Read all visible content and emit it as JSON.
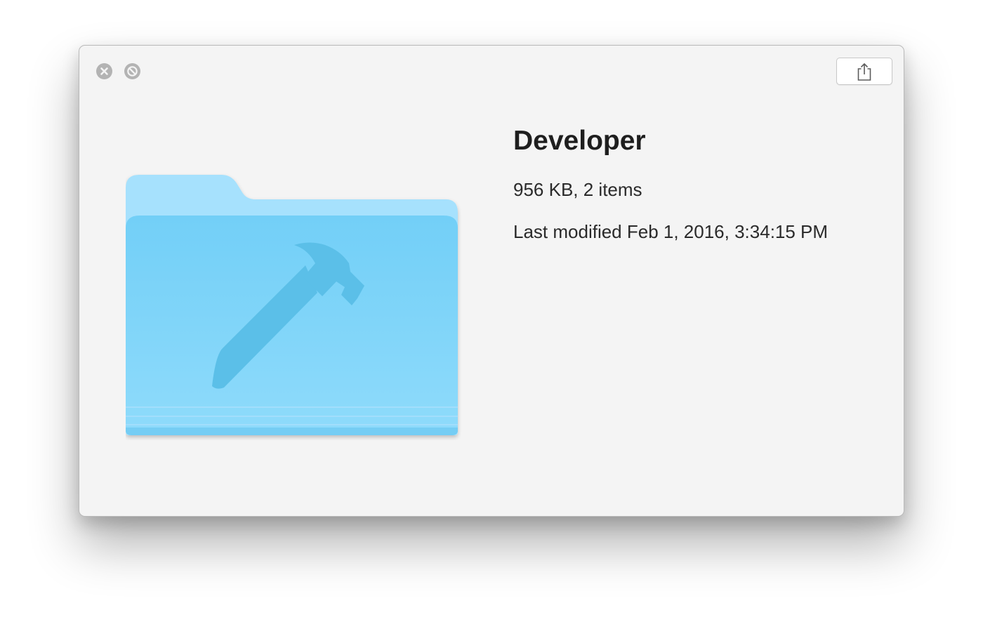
{
  "window": {
    "controls": {
      "close_icon": "close-icon",
      "fullscreen_icon": "fullscreen-disabled-icon"
    },
    "share_icon": "share-icon"
  },
  "file": {
    "name": "Developer",
    "size_summary": "956 KB, 2 items",
    "modified": "Last modified Feb 1, 2016, 3:34:15 PM",
    "icon": "developer-folder-icon",
    "icon_glyph": "hammer-icon"
  },
  "colors": {
    "window_background": "#f4f4f4",
    "folder_blue": "#7fd2f8",
    "folder_tab": "#a6e1fd",
    "hammer": "#5bbfe8",
    "window_control": "#b3b3b3"
  }
}
